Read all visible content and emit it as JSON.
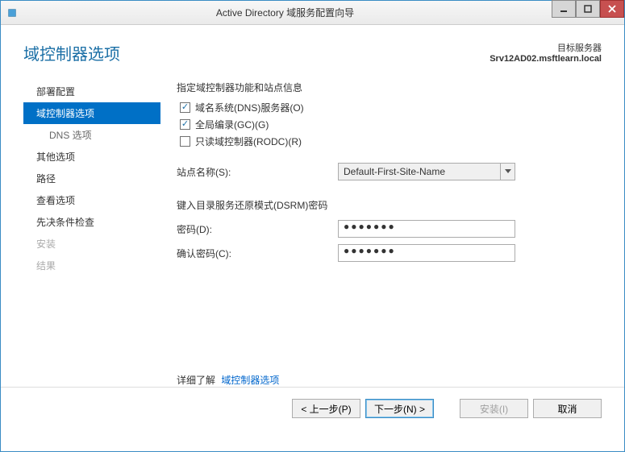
{
  "window": {
    "title": "Active Directory 域服务配置向导"
  },
  "header": {
    "title": "域控制器选项",
    "target_label": "目标服务器",
    "target_value": "Srv12AD02.msftlearn.local"
  },
  "sidebar": {
    "items": [
      {
        "label": "部署配置",
        "selected": false
      },
      {
        "label": "域控制器选项",
        "selected": true
      },
      {
        "label": "DNS 选项",
        "selected": false,
        "sub": true
      },
      {
        "label": "其他选项",
        "selected": false
      },
      {
        "label": "路径",
        "selected": false
      },
      {
        "label": "查看选项",
        "selected": false
      },
      {
        "label": "先决条件检查",
        "selected": false
      },
      {
        "label": "安装",
        "selected": false,
        "disabled": true
      },
      {
        "label": "结果",
        "selected": false,
        "disabled": true
      }
    ]
  },
  "main": {
    "capabilities_label": "指定域控制器功能和站点信息",
    "checkboxes": {
      "dns": {
        "label": "域名系统(DNS)服务器(O)",
        "checked": true
      },
      "gc": {
        "label": "全局编录(GC)(G)",
        "checked": true
      },
      "rodc": {
        "label": "只读域控制器(RODC)(R)",
        "checked": false
      }
    },
    "site_label": "站点名称(S):",
    "site_value": "Default-First-Site-Name",
    "dsrm_label": "键入目录服务还原模式(DSRM)密码",
    "password_label": "密码(D):",
    "password_value": "●●●●●●●",
    "confirm_label": "确认密码(C):",
    "confirm_value": "●●●●●●●",
    "more_info_text": "详细了解",
    "more_info_link": "域控制器选项"
  },
  "footer": {
    "prev": "< 上一步(P)",
    "next": "下一步(N) >",
    "install": "安装(I)",
    "cancel": "取消"
  }
}
